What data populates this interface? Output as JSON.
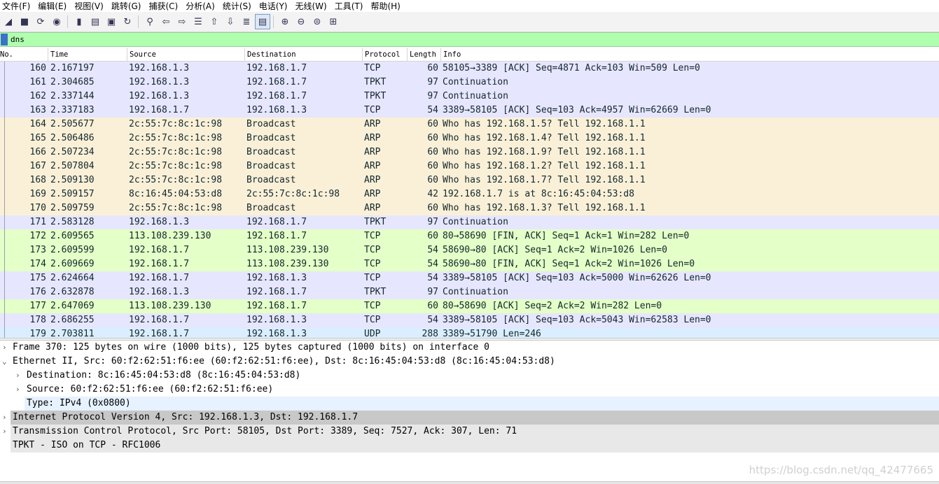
{
  "menu": [
    "文件(F)",
    "编辑(E)",
    "视图(V)",
    "跳转(G)",
    "捕获(C)",
    "分析(A)",
    "统计(S)",
    "电话(Y)",
    "无线(W)",
    "工具(T)",
    "帮助(H)"
  ],
  "toolbar": {
    "icons": [
      "shark-fin-start-icon",
      "stop-icon",
      "restart-icon",
      "options-gear-icon",
      "open-file-icon",
      "save-file-icon",
      "close-file-icon",
      "reload-icon",
      "find-icon",
      "go-back-icon",
      "go-forward-icon",
      "go-to-packet-icon",
      "first-packet-icon",
      "last-packet-icon",
      "autoscroll-icon",
      "colorize-icon",
      "zoom-in-icon",
      "zoom-out-icon",
      "zoom-normal-icon",
      "resize-columns-icon"
    ],
    "glyphs": [
      "◢",
      "■",
      "⟳",
      "◉",
      "▮",
      "▤",
      "▣",
      "↻",
      "⚲",
      "⇦",
      "⇨",
      "☰",
      "⇧",
      "⇩",
      "≣",
      "▤",
      "⊕",
      "⊖",
      "⊜",
      "⊞"
    ]
  },
  "filter": {
    "value": "dns"
  },
  "columns": {
    "no": "No.",
    "time": "Time",
    "source": "Source",
    "destination": "Destination",
    "protocol": "Protocol",
    "length": "Length",
    "info": "Info"
  },
  "colors": {
    "tcp": "#e7e6ff",
    "arp": "#faf0d7",
    "green": "#e4ffc7",
    "udp": "#daeeff",
    "selected": "#c8c8c8",
    "type_highlight": "#e6f2ff",
    "filter_bg": "#afffaf"
  },
  "packets": [
    {
      "no": "160",
      "time": "2.167197",
      "source": "192.168.1.3",
      "destination": "192.168.1.7",
      "protocol": "TCP",
      "length": "60",
      "info": "58105→3389 [ACK] Seq=4871 Ack=103 Win=509 Len=0",
      "color": "#e7e6ff"
    },
    {
      "no": "161",
      "time": "2.304685",
      "source": "192.168.1.3",
      "destination": "192.168.1.7",
      "protocol": "TPKT",
      "length": "97",
      "info": "Continuation",
      "color": "#e7e6ff"
    },
    {
      "no": "162",
      "time": "2.337144",
      "source": "192.168.1.3",
      "destination": "192.168.1.7",
      "protocol": "TPKT",
      "length": "97",
      "info": "Continuation",
      "color": "#e7e6ff"
    },
    {
      "no": "163",
      "time": "2.337183",
      "source": "192.168.1.7",
      "destination": "192.168.1.3",
      "protocol": "TCP",
      "length": "54",
      "info": "3389→58105 [ACK] Seq=103 Ack=4957 Win=62669 Len=0",
      "color": "#e7e6ff"
    },
    {
      "no": "164",
      "time": "2.505677",
      "source": "2c:55:7c:8c:1c:98",
      "destination": "Broadcast",
      "protocol": "ARP",
      "length": "60",
      "info": "Who has 192.168.1.5? Tell 192.168.1.1",
      "color": "#faf0d7"
    },
    {
      "no": "165",
      "time": "2.506486",
      "source": "2c:55:7c:8c:1c:98",
      "destination": "Broadcast",
      "protocol": "ARP",
      "length": "60",
      "info": "Who has 192.168.1.4? Tell 192.168.1.1",
      "color": "#faf0d7"
    },
    {
      "no": "166",
      "time": "2.507234",
      "source": "2c:55:7c:8c:1c:98",
      "destination": "Broadcast",
      "protocol": "ARP",
      "length": "60",
      "info": "Who has 192.168.1.9? Tell 192.168.1.1",
      "color": "#faf0d7"
    },
    {
      "no": "167",
      "time": "2.507804",
      "source": "2c:55:7c:8c:1c:98",
      "destination": "Broadcast",
      "protocol": "ARP",
      "length": "60",
      "info": "Who has 192.168.1.2? Tell 192.168.1.1",
      "color": "#faf0d7"
    },
    {
      "no": "168",
      "time": "2.509130",
      "source": "2c:55:7c:8c:1c:98",
      "destination": "Broadcast",
      "protocol": "ARP",
      "length": "60",
      "info": "Who has 192.168.1.7? Tell 192.168.1.1",
      "color": "#faf0d7"
    },
    {
      "no": "169",
      "time": "2.509157",
      "source": "8c:16:45:04:53:d8",
      "destination": "2c:55:7c:8c:1c:98",
      "protocol": "ARP",
      "length": "42",
      "info": "192.168.1.7 is at 8c:16:45:04:53:d8",
      "color": "#faf0d7"
    },
    {
      "no": "170",
      "time": "2.509759",
      "source": "2c:55:7c:8c:1c:98",
      "destination": "Broadcast",
      "protocol": "ARP",
      "length": "60",
      "info": "Who has 192.168.1.3? Tell 192.168.1.1",
      "color": "#faf0d7"
    },
    {
      "no": "171",
      "time": "2.583128",
      "source": "192.168.1.3",
      "destination": "192.168.1.7",
      "protocol": "TPKT",
      "length": "97",
      "info": "Continuation",
      "color": "#e7e6ff"
    },
    {
      "no": "172",
      "time": "2.609565",
      "source": "113.108.239.130",
      "destination": "192.168.1.7",
      "protocol": "TCP",
      "length": "60",
      "info": "80→58690 [FIN, ACK] Seq=1 Ack=1 Win=282 Len=0",
      "color": "#e4ffc7"
    },
    {
      "no": "173",
      "time": "2.609599",
      "source": "192.168.1.7",
      "destination": "113.108.239.130",
      "protocol": "TCP",
      "length": "54",
      "info": "58690→80 [ACK] Seq=1 Ack=2 Win=1026 Len=0",
      "color": "#e4ffc7"
    },
    {
      "no": "174",
      "time": "2.609669",
      "source": "192.168.1.7",
      "destination": "113.108.239.130",
      "protocol": "TCP",
      "length": "54",
      "info": "58690→80 [FIN, ACK] Seq=1 Ack=2 Win=1026 Len=0",
      "color": "#e4ffc7"
    },
    {
      "no": "175",
      "time": "2.624664",
      "source": "192.168.1.7",
      "destination": "192.168.1.3",
      "protocol": "TCP",
      "length": "54",
      "info": "3389→58105 [ACK] Seq=103 Ack=5000 Win=62626 Len=0",
      "color": "#e7e6ff"
    },
    {
      "no": "176",
      "time": "2.632878",
      "source": "192.168.1.3",
      "destination": "192.168.1.7",
      "protocol": "TPKT",
      "length": "97",
      "info": "Continuation",
      "color": "#e7e6ff"
    },
    {
      "no": "177",
      "time": "2.647069",
      "source": "113.108.239.130",
      "destination": "192.168.1.7",
      "protocol": "TCP",
      "length": "60",
      "info": "80→58690 [ACK] Seq=2 Ack=2 Win=282 Len=0",
      "color": "#e4ffc7"
    },
    {
      "no": "178",
      "time": "2.686255",
      "source": "192.168.1.7",
      "destination": "192.168.1.3",
      "protocol": "TCP",
      "length": "54",
      "info": "3389→58105 [ACK] Seq=103 Ack=5043 Win=62583 Len=0",
      "color": "#e7e6ff"
    },
    {
      "no": "179",
      "time": "2.703811",
      "source": "192.168.1.7",
      "destination": "192.168.1.3",
      "protocol": "UDP",
      "length": "288",
      "info": "3389→51790 Len=246",
      "color": "#daeeff"
    }
  ],
  "details": [
    {
      "level": 0,
      "arrow": "›",
      "text": "Frame 370: 125 bytes on wire (1000 bits), 125 bytes captured (1000 bits) on interface 0",
      "bg": "#ffffff"
    },
    {
      "level": 0,
      "arrow": "⌄",
      "text": "Ethernet II, Src: 60:f2:62:51:f6:ee (60:f2:62:51:f6:ee), Dst: 8c:16:45:04:53:d8 (8c:16:45:04:53:d8)",
      "bg": "#ffffff"
    },
    {
      "level": 1,
      "arrow": "›",
      "text": "Destination: 8c:16:45:04:53:d8 (8c:16:45:04:53:d8)",
      "bg": "#ffffff"
    },
    {
      "level": 1,
      "arrow": "›",
      "text": "Source: 60:f2:62:51:f6:ee (60:f2:62:51:f6:ee)",
      "bg": "#ffffff"
    },
    {
      "level": 1,
      "arrow": "",
      "text": "Type: IPv4 (0x0800)",
      "bg": "#e6f2ff"
    },
    {
      "level": 0,
      "arrow": "›",
      "text": "Internet Protocol Version 4, Src: 192.168.1.3, Dst: 192.168.1.7",
      "bg": "#c8c8c8"
    },
    {
      "level": 0,
      "arrow": "›",
      "text": "Transmission Control Protocol, Src Port: 58105, Dst Port: 3389, Seq: 7527, Ack: 307, Len: 71",
      "bg": "#e8e8e8"
    },
    {
      "level": 0,
      "arrow": "",
      "text": "TPKT - ISO on TCP - RFC1006",
      "bg": "#e8e8e8"
    }
  ],
  "watermark": "https://blog.csdn.net/qq_42477665"
}
